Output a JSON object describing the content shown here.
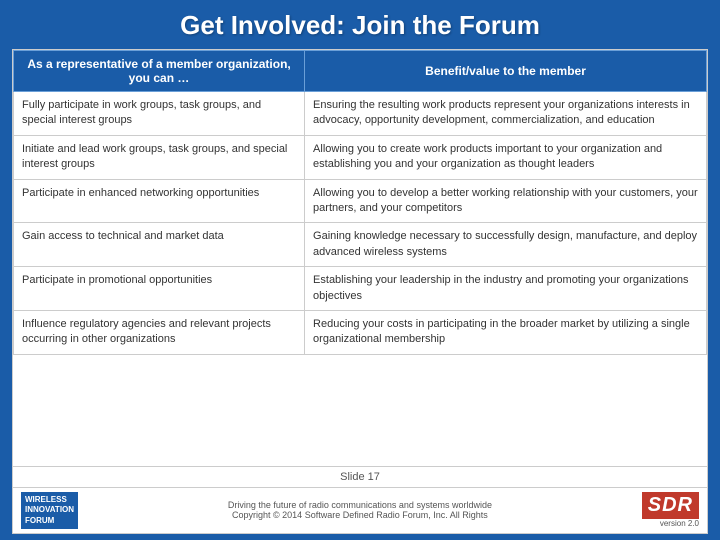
{
  "header": {
    "title": "Get Involved: Join the Forum"
  },
  "table": {
    "col1_header": "As a representative of a member organization, you can …",
    "col2_header": "Benefit/value to the member",
    "rows": [
      {
        "action": "Fully participate in work groups, task groups, and special interest groups",
        "benefit": "Ensuring the resulting work products represent your organizations interests in advocacy, opportunity development, commercialization, and education"
      },
      {
        "action": "Initiate and lead work groups, task groups, and special interest groups",
        "benefit": "Allowing you to create work products important to your organization and establishing you and your organization as thought leaders"
      },
      {
        "action": "Participate in enhanced networking opportunities",
        "benefit": "Allowing you to develop a better working relationship with your customers, your partners, and your competitors"
      },
      {
        "action": "Gain access to technical and market data",
        "benefit": "Gaining knowledge necessary to successfully design, manufacture, and deploy advanced wireless systems"
      },
      {
        "action": "Participate in promotional opportunities",
        "benefit": "Establishing your leadership in the industry and promoting your organizations objectives"
      },
      {
        "action": "Influence regulatory agencies and relevant projects occurring in other organizations",
        "benefit": "Reducing your costs in participating in the broader market by utilizing a single organizational membership"
      }
    ]
  },
  "footer": {
    "slide_label": "Slide 17",
    "tagline": "Driving the future of radio communications and systems worldwide",
    "copyright": "Copyright © 2014 Software Defined Radio Forum, Inc. All Rights",
    "wif_line1": "Wireless",
    "wif_line2": "Innovation",
    "wif_line3": "Forum",
    "sdr_label": "SDR",
    "sdr_version": "version 2.0"
  }
}
